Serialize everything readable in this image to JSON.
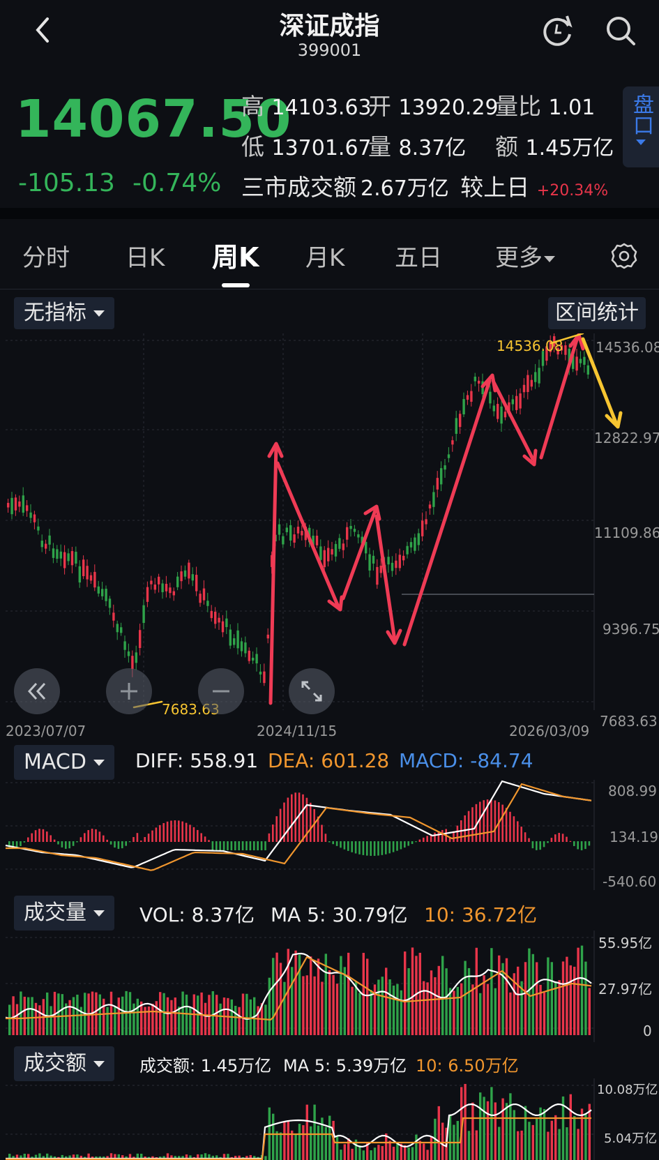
{
  "header": {
    "title": "深证成指",
    "code": "399001"
  },
  "quote": {
    "price": "14067.50",
    "change": "-105.13",
    "change_pct": "-0.74%",
    "high_label": "高",
    "high": "14103.63",
    "open_label": "开",
    "open": "13920.29",
    "ratio_label": "量比",
    "ratio": "1.01",
    "low_label": "低",
    "low": "13701.67",
    "vol_label": "量",
    "vol": "8.37亿",
    "amt_label": "额",
    "amt": "1.45万亿",
    "market_label": "三市成交额",
    "market_amt": "2.67万亿",
    "vs_label": "较上日",
    "vs_pct": "+20.34%",
    "panel_label": "盘口"
  },
  "tabs": [
    {
      "label": "分时"
    },
    {
      "label": "日K"
    },
    {
      "label": "周K"
    },
    {
      "label": "月K"
    },
    {
      "label": "五日"
    },
    {
      "label": "更多"
    }
  ],
  "toolbar": {
    "indicator": "无指标",
    "range_stats": "区间统计"
  },
  "colors": {
    "up": "#e8354a",
    "down": "#2fa34a",
    "white_line": "#ffffff",
    "orange_line": "#f0962e",
    "blue": "#4a8fe8",
    "annotation_red": "#ef3b55",
    "annotation_yellow": "#f7c531",
    "accent": "#3b7ae8"
  },
  "icons": [
    "back-icon",
    "refresh-icon",
    "search-icon",
    "settings-icon",
    "collapse-icon",
    "zoom-in-icon",
    "zoom-out-icon",
    "fullscreen-icon"
  ],
  "kline": {
    "y_labels": [
      "14536.08",
      "12822.97",
      "11109.86",
      "9396.75",
      "7683.63"
    ],
    "x_labels": [
      "2023/07/07",
      "2024/11/15",
      "2026/03/09"
    ],
    "max_label": "14536.08",
    "min_label": "7683.63"
  },
  "macd": {
    "label": "MACD",
    "diff": "DIFF: 558.91",
    "dea": "DEA: 601.28",
    "macd": "MACD: -84.74",
    "y_labels": [
      "808.99",
      "134.19",
      "-540.60"
    ]
  },
  "vol": {
    "label": "成交量",
    "vol": "VOL: 8.37亿",
    "ma5": "MA 5: 30.79亿",
    "ma10": "10: 36.72亿",
    "y_labels": [
      "55.95亿",
      "27.97亿",
      "0"
    ]
  },
  "amt": {
    "label": "成交额",
    "amt": "成交额: 1.45万亿",
    "ma5": "MA 5: 5.39万亿",
    "ma10": "10: 6.50万亿",
    "y_labels": [
      "10.08万亿",
      "5.04万亿"
    ]
  }
}
